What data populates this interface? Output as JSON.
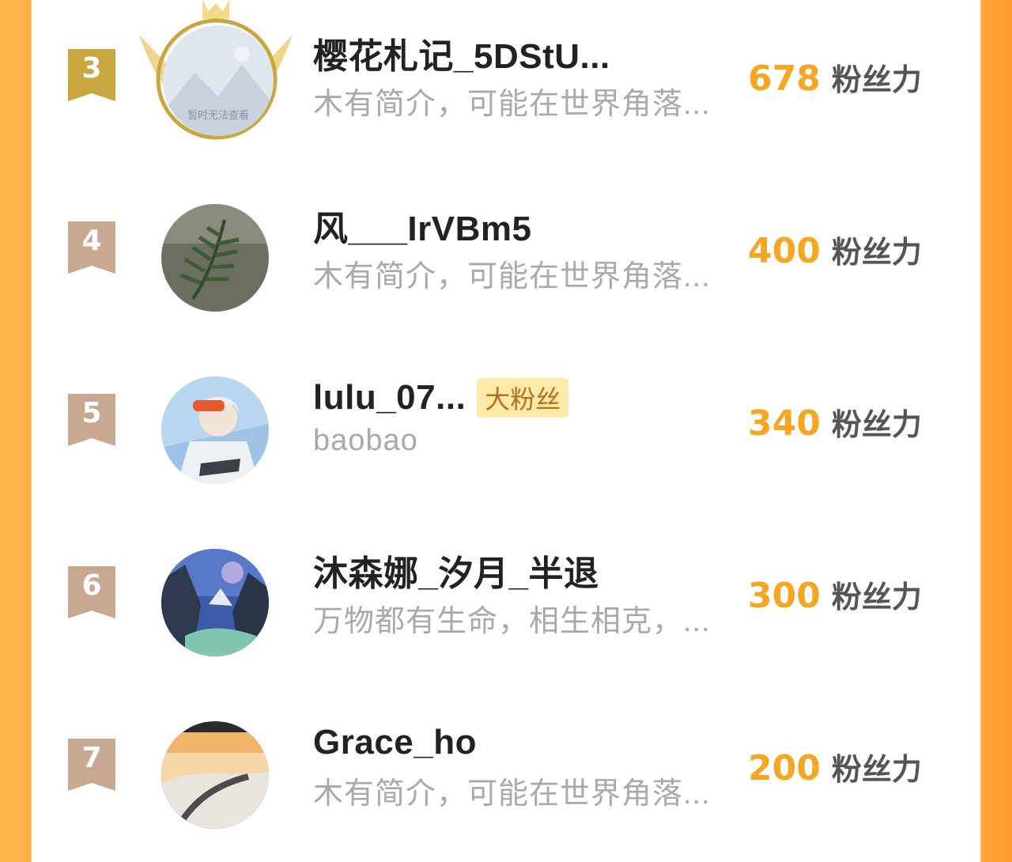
{
  "ranking": {
    "unit_label": "粉丝力",
    "rows": [
      {
        "rank": "3",
        "name": "樱花札记_5DStU...",
        "badge": "",
        "bio": "木有简介，可能在世界角落...",
        "score": "678",
        "avatar_text": "暂时无法查看"
      },
      {
        "rank": "4",
        "name": "风___IrVBm5",
        "badge": "",
        "bio": "木有简介，可能在世界角落...",
        "score": "400"
      },
      {
        "rank": "5",
        "name": "lulu_07...",
        "badge": "大粉丝",
        "bio": "baobao",
        "score": "340"
      },
      {
        "rank": "6",
        "name": "沐森娜_汐月_半退",
        "badge": "",
        "bio": "万物都有生命，相生相克，...",
        "score": "300"
      },
      {
        "rank": "7",
        "name": "Grace_ho",
        "badge": "",
        "bio": "木有简介，可能在世界角落...",
        "score": "200"
      }
    ]
  },
  "colors": {
    "accent": "#f5a623",
    "rank3_badge": "#c9a640",
    "rank_badge": "#c8a890",
    "border_left": "#ffb648",
    "border_right": "#ff9a2e"
  }
}
